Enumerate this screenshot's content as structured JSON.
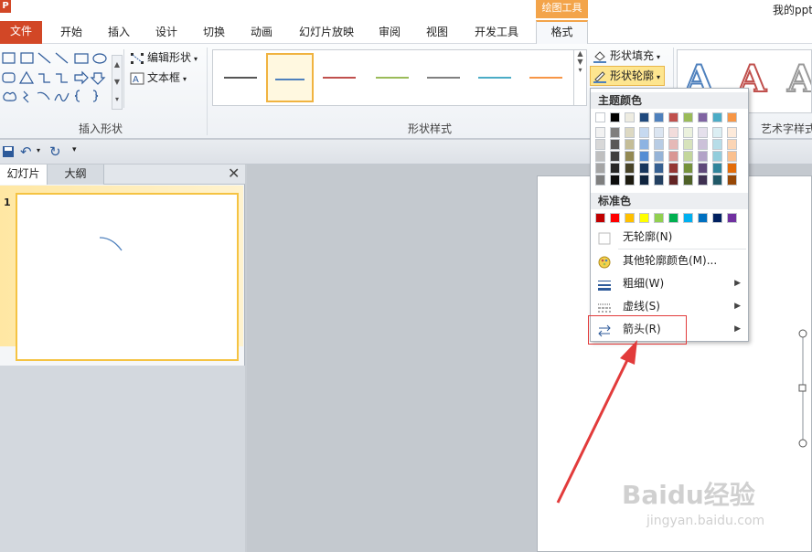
{
  "app": {
    "logo_text": "P",
    "context_tab_title": "绘图工具",
    "doc_title": "我的ppt"
  },
  "tabs": [
    {
      "label": "文件"
    },
    {
      "label": "开始"
    },
    {
      "label": "插入"
    },
    {
      "label": "设计"
    },
    {
      "label": "切换"
    },
    {
      "label": "动画"
    },
    {
      "label": "幻灯片放映"
    },
    {
      "label": "审阅"
    },
    {
      "label": "视图"
    },
    {
      "label": "开发工具"
    },
    {
      "label": "格式"
    }
  ],
  "ribbon": {
    "edit_shape_label": "编辑形状",
    "textbox_label": "文本框",
    "insert_shapes_group": "插入形状",
    "shape_styles_group": "形状样式",
    "fill_label": "形状填充",
    "outline_label": "形状轮廓",
    "wordart_group": "艺术字样式",
    "wordart_letter": "A"
  },
  "style_colors": [
    "#555555",
    "#4f81bd",
    "#c0504d",
    "#9bbb59",
    "#808080",
    "#4bacc6",
    "#f79646"
  ],
  "left_panel": {
    "tab_slides": "幻灯片",
    "tab_outline": "大纲",
    "close_glyph": "✕",
    "slide_number": "1"
  },
  "menu": {
    "theme_colors_header": "主题颜色",
    "theme_top_row": [
      "#ffffff",
      "#000000",
      "#eeece1",
      "#1f497d",
      "#4f81bd",
      "#c0504d",
      "#9bbb59",
      "#8064a2",
      "#4bacc6",
      "#f79646"
    ],
    "theme_shades": [
      [
        "#f2f2f2",
        "#7f7f7f",
        "#ddd9c3",
        "#c6d9f0",
        "#dbe5f1",
        "#f2dcdb",
        "#ebf1dd",
        "#e5e0ec",
        "#dbeef3",
        "#fdeada"
      ],
      [
        "#d8d8d8",
        "#595959",
        "#c4bd97",
        "#8db3e2",
        "#b8cce4",
        "#e5b9b7",
        "#d7e3bc",
        "#ccc1d9",
        "#b7dde8",
        "#fbd5b5"
      ],
      [
        "#bfbfbf",
        "#3f3f3f",
        "#938953",
        "#548dd4",
        "#95b3d7",
        "#d99694",
        "#c3d69b",
        "#b2a2c7",
        "#92cddc",
        "#fac08f"
      ],
      [
        "#a5a5a5",
        "#262626",
        "#494429",
        "#17365d",
        "#366092",
        "#953734",
        "#76923c",
        "#5f497a",
        "#31859b",
        "#e36c09"
      ],
      [
        "#7f7f7f",
        "#0c0c0c",
        "#1d1b10",
        "#0f243e",
        "#244061",
        "#632423",
        "#4f6128",
        "#3f3151",
        "#205867",
        "#974806"
      ]
    ],
    "standard_colors_header": "标准色",
    "standard_colors": [
      "#c00000",
      "#ff0000",
      "#ffc000",
      "#ffff00",
      "#92d050",
      "#00b050",
      "#00b0f0",
      "#0070c0",
      "#002060",
      "#7030a0"
    ],
    "no_outline": "无轮廓(N)",
    "more_colors": "其他轮廓颜色(M)...",
    "weight": "粗细(W)",
    "dashes": "虚线(S)",
    "arrows": "箭头(R)",
    "submenu_arrow": "▶"
  },
  "watermark": {
    "text": "Baidu经验",
    "sub": "jingyan.baidu.com"
  }
}
